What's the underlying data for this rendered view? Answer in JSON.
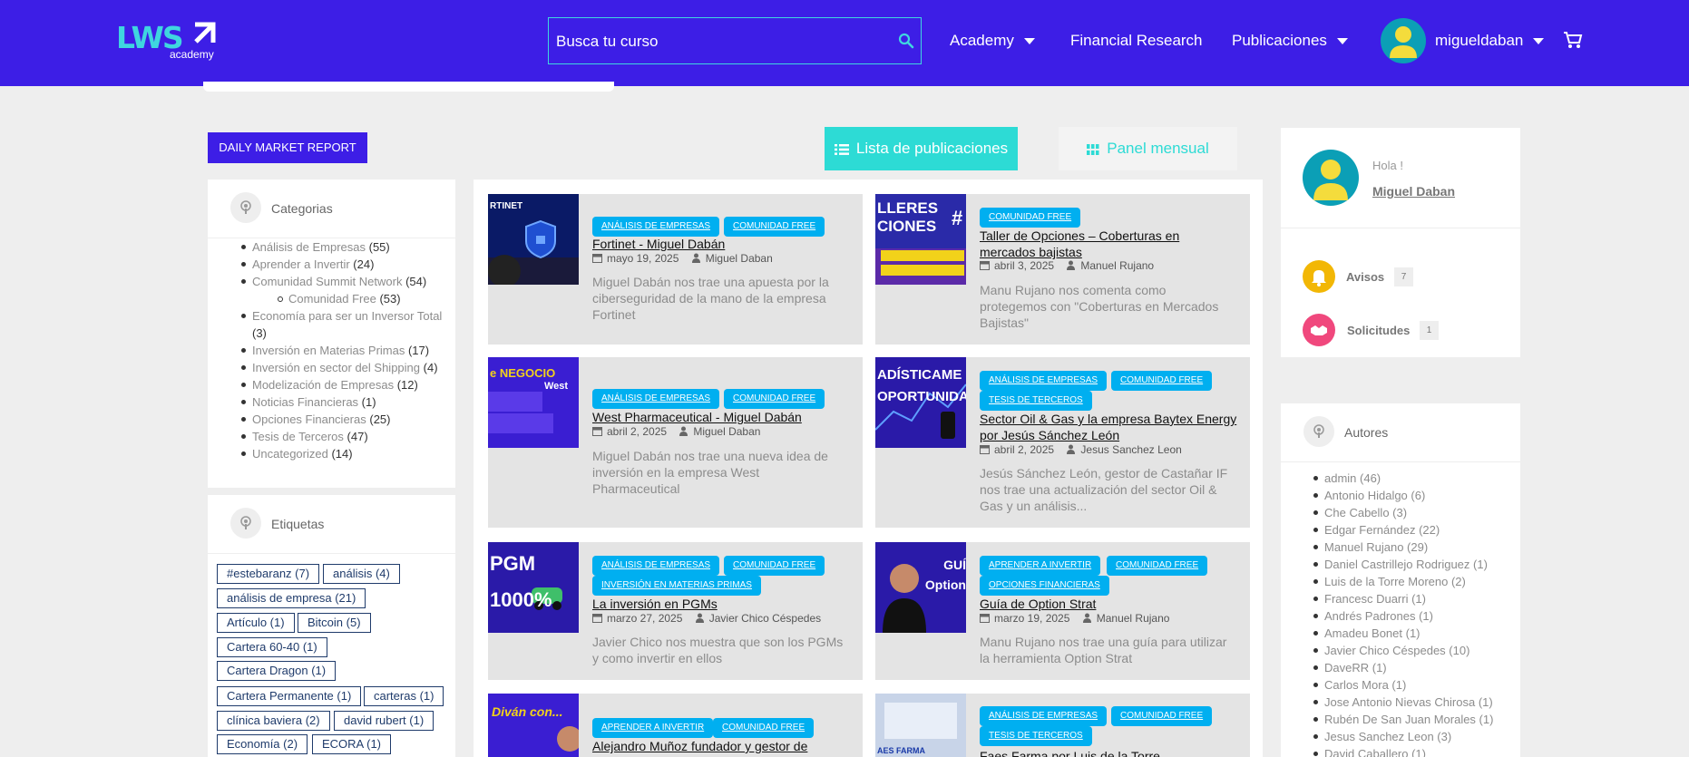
{
  "header": {
    "logo_text": "LWS",
    "logo_sub": "academy",
    "search_placeholder": "Busca tu curso",
    "nav": [
      "Academy",
      "Financial Research",
      "Publicaciones"
    ],
    "username": "migueldaban"
  },
  "toolbar": {
    "daily_report": "DAILY MARKET REPORT",
    "tab_list": "Lista de publicaciones",
    "tab_panel": "Panel mensual"
  },
  "categories": {
    "title": "Categorias",
    "items": [
      {
        "name": "Análisis de Empresas",
        "count": "(55)"
      },
      {
        "name": "Aprender a Invertir",
        "count": "(24)"
      },
      {
        "name": "Comunidad Summit Network",
        "count": "(54)"
      },
      {
        "name": "Comunidad Free",
        "count": "(53)"
      },
      {
        "name": "Economía para ser un Inversor Total",
        "count": "(3)"
      },
      {
        "name": "Inversión en Materias Primas",
        "count": "(17)"
      },
      {
        "name": "Inversión en sector del Shipping",
        "count": "(4)"
      },
      {
        "name": "Modelización de Empresas",
        "count": "(12)"
      },
      {
        "name": "Noticias Financieras",
        "count": "(1)"
      },
      {
        "name": "Opciones Financieras",
        "count": "(25)"
      },
      {
        "name": "Tesis de Terceros",
        "count": "(47)"
      },
      {
        "name": "Uncategorized",
        "count": "(14)"
      }
    ]
  },
  "tags": {
    "title": "Etiquetas",
    "items": [
      "#estebaranz (7)",
      "análisis (4)",
      "análisis de empresa (21)",
      "Artículo (1)",
      "Bitcoin (5)",
      "Cartera 60-40 (1)",
      "Cartera Dragon (1)",
      "Cartera Permanente (1)",
      "carteras (1)",
      "clínica baviera (2)",
      "david rubert (1)",
      "Economía (2)",
      "ECORA (1)"
    ]
  },
  "posts": [
    {
      "badges": [
        "ANÁLISIS DE EMPRESAS",
        "COMUNIDAD FREE"
      ],
      "title": "Fortinet - Miguel Dabán",
      "date": "mayo 19, 2025",
      "author": "Miguel Daban",
      "excerpt": "Miguel Dabán nos trae una apuesta por la ciberseguridad de la mano de la empresa Fortinet",
      "thumb_text": "RTINET"
    },
    {
      "badges": [
        "COMUNIDAD FREE"
      ],
      "title": "Taller de Opciones – Coberturas en mercados bajistas",
      "date": "abril 3, 2025",
      "author": "Manuel Rujano",
      "excerpt": "Manu Rujano nos comenta como protegemos con \"Coberturas en Mercados Bajistas\"",
      "thumb_text": "LLERES CIONES"
    },
    {
      "badges": [
        "ANÁLISIS DE EMPRESAS",
        "COMUNIDAD FREE"
      ],
      "title": "West Pharmaceutical - Miguel Dabán",
      "date": "abril 2, 2025",
      "author": "Miguel Daban",
      "excerpt": "Miguel Dabán nos trae una nueva idea de inversión en la empresa West Pharmaceutical",
      "thumb_text": "e NEGOCIO"
    },
    {
      "badges": [
        "ANÁLISIS DE EMPRESAS",
        "COMUNIDAD FREE",
        "TESIS DE TERCEROS"
      ],
      "title": "Sector Oil & Gas y la empresa Baytex Energy por Jesús Sánchez León",
      "date": "abril 2, 2025",
      "author": "Jesus Sanchez Leon",
      "excerpt": "Jesús Sánchez León, gestor de Castañar IF nos trae una actualización del sector Oil & Gas y un análisis...",
      "thumb_text": "ADÍSTICAME OPORTUNIDA"
    },
    {
      "badges": [
        "ANÁLISIS DE EMPRESAS",
        "COMUNIDAD FREE",
        "INVERSIÓN EN MATERIAS PRIMAS"
      ],
      "title": "La inversión en PGMs",
      "date": "marzo 27, 2025",
      "author": "Javier Chico Céspedes",
      "excerpt": "Javier Chico nos muestra que son los PGMs y como invertir en ellos",
      "thumb_text": "PGM 1000%"
    },
    {
      "badges": [
        "APRENDER A INVERTIR",
        "COMUNIDAD FREE",
        "OPCIONES FINANCIERAS"
      ],
      "title": "Guía de Option Strat",
      "date": "marzo 19, 2025",
      "author": "Manuel Rujano",
      "excerpt": "Manu Rujano nos trae una guía para utilizar la herramienta Option Strat",
      "thumb_text": "GUÍ Option"
    },
    {
      "badges": [
        "APRENDER A INVERTIR",
        "COMUNIDAD FREE"
      ],
      "title": "Alejandro Muñoz fundador y gestor de",
      "date": "",
      "author": "",
      "excerpt": "",
      "thumb_text": "Diván con..."
    },
    {
      "badges": [
        "ANÁLISIS DE EMPRESAS",
        "COMUNIDAD FREE",
        "TESIS DE TERCEROS"
      ],
      "title": "Faes Farma por Luis de la Torre",
      "date": "",
      "author": "",
      "excerpt": "",
      "thumb_text": "AES FARMA"
    }
  ],
  "profile": {
    "greeting": "Hola !",
    "name": "Miguel Daban",
    "avisos_label": "Avisos",
    "avisos_count": "7",
    "solicitudes_label": "Solicitudes",
    "solicitudes_count": "1"
  },
  "authors": {
    "title": "Autores",
    "items": [
      "admin (46)",
      "Antonio Hidalgo (6)",
      "Che Cabello (3)",
      "Edgar Fernández (22)",
      "Manuel Rujano (29)",
      "Daniel Castrillejo Rodriguez (1)",
      "Luis de la Torre Moreno (2)",
      "Francesc Duarri (1)",
      "Andrés Padrones (1)",
      "Amadeu Bonet (1)",
      "Javier Chico Céspedes (10)",
      "DaveRR (1)",
      "Carlos Mora (1)",
      "Jose Antonio Nievas Chirosa (1)",
      "Rubén De San Juan Morales (1)",
      "Jesus Sanchez Leon (3)",
      "David Caballero (1)"
    ]
  },
  "colors": {
    "header": "#3d1ee6",
    "accent": "#2ddbd5",
    "badge": "#00aff0"
  }
}
